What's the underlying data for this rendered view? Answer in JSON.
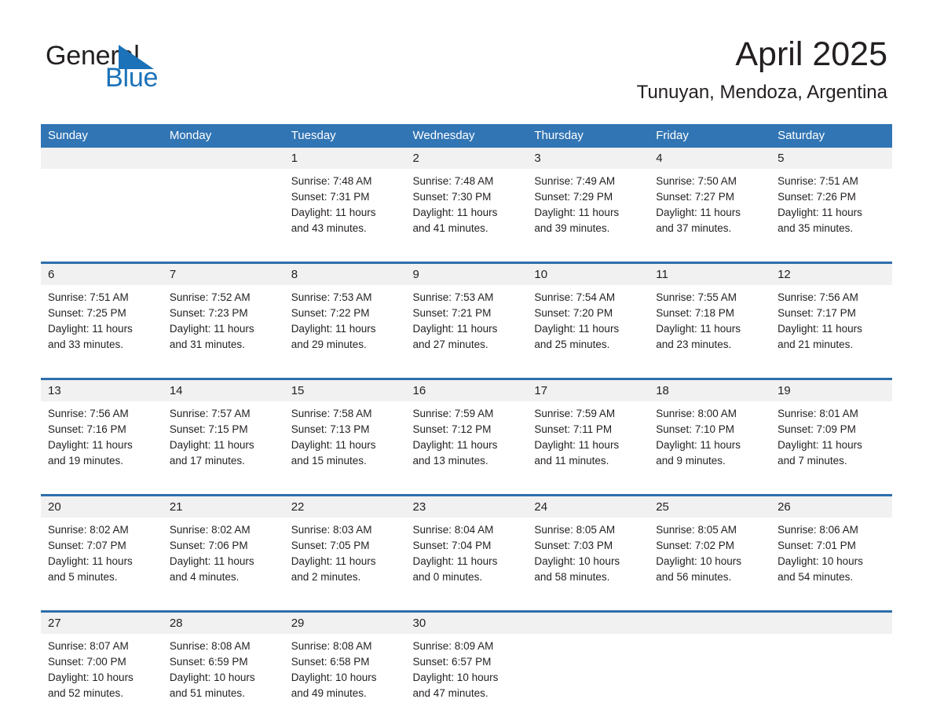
{
  "logo": {
    "text_top": "General",
    "text_bottom": "Blue",
    "triangle_icon": "blue-triangle-icon",
    "accent_color": "#1b72b8"
  },
  "header": {
    "title": "April 2025",
    "location": "Tunuyan, Mendoza, Argentina"
  },
  "colors": {
    "header_blue": "#3175b4",
    "separator_blue": "#2e6fab",
    "daynum_band": "#f1f1f1",
    "text": "#231f20"
  },
  "weekdays": [
    "Sunday",
    "Monday",
    "Tuesday",
    "Wednesday",
    "Thursday",
    "Friday",
    "Saturday"
  ],
  "weeks": [
    [
      {
        "day": "",
        "l1": "",
        "l2": "",
        "l3": "",
        "l4": ""
      },
      {
        "day": "",
        "l1": "",
        "l2": "",
        "l3": "",
        "l4": ""
      },
      {
        "day": "1",
        "l1": "Sunrise: 7:48 AM",
        "l2": "Sunset: 7:31 PM",
        "l3": "Daylight: 11 hours",
        "l4": "and 43 minutes."
      },
      {
        "day": "2",
        "l1": "Sunrise: 7:48 AM",
        "l2": "Sunset: 7:30 PM",
        "l3": "Daylight: 11 hours",
        "l4": "and 41 minutes."
      },
      {
        "day": "3",
        "l1": "Sunrise: 7:49 AM",
        "l2": "Sunset: 7:29 PM",
        "l3": "Daylight: 11 hours",
        "l4": "and 39 minutes."
      },
      {
        "day": "4",
        "l1": "Sunrise: 7:50 AM",
        "l2": "Sunset: 7:27 PM",
        "l3": "Daylight: 11 hours",
        "l4": "and 37 minutes."
      },
      {
        "day": "5",
        "l1": "Sunrise: 7:51 AM",
        "l2": "Sunset: 7:26 PM",
        "l3": "Daylight: 11 hours",
        "l4": "and 35 minutes."
      }
    ],
    [
      {
        "day": "6",
        "l1": "Sunrise: 7:51 AM",
        "l2": "Sunset: 7:25 PM",
        "l3": "Daylight: 11 hours",
        "l4": "and 33 minutes."
      },
      {
        "day": "7",
        "l1": "Sunrise: 7:52 AM",
        "l2": "Sunset: 7:23 PM",
        "l3": "Daylight: 11 hours",
        "l4": "and 31 minutes."
      },
      {
        "day": "8",
        "l1": "Sunrise: 7:53 AM",
        "l2": "Sunset: 7:22 PM",
        "l3": "Daylight: 11 hours",
        "l4": "and 29 minutes."
      },
      {
        "day": "9",
        "l1": "Sunrise: 7:53 AM",
        "l2": "Sunset: 7:21 PM",
        "l3": "Daylight: 11 hours",
        "l4": "and 27 minutes."
      },
      {
        "day": "10",
        "l1": "Sunrise: 7:54 AM",
        "l2": "Sunset: 7:20 PM",
        "l3": "Daylight: 11 hours",
        "l4": "and 25 minutes."
      },
      {
        "day": "11",
        "l1": "Sunrise: 7:55 AM",
        "l2": "Sunset: 7:18 PM",
        "l3": "Daylight: 11 hours",
        "l4": "and 23 minutes."
      },
      {
        "day": "12",
        "l1": "Sunrise: 7:56 AM",
        "l2": "Sunset: 7:17 PM",
        "l3": "Daylight: 11 hours",
        "l4": "and 21 minutes."
      }
    ],
    [
      {
        "day": "13",
        "l1": "Sunrise: 7:56 AM",
        "l2": "Sunset: 7:16 PM",
        "l3": "Daylight: 11 hours",
        "l4": "and 19 minutes."
      },
      {
        "day": "14",
        "l1": "Sunrise: 7:57 AM",
        "l2": "Sunset: 7:15 PM",
        "l3": "Daylight: 11 hours",
        "l4": "and 17 minutes."
      },
      {
        "day": "15",
        "l1": "Sunrise: 7:58 AM",
        "l2": "Sunset: 7:13 PM",
        "l3": "Daylight: 11 hours",
        "l4": "and 15 minutes."
      },
      {
        "day": "16",
        "l1": "Sunrise: 7:59 AM",
        "l2": "Sunset: 7:12 PM",
        "l3": "Daylight: 11 hours",
        "l4": "and 13 minutes."
      },
      {
        "day": "17",
        "l1": "Sunrise: 7:59 AM",
        "l2": "Sunset: 7:11 PM",
        "l3": "Daylight: 11 hours",
        "l4": "and 11 minutes."
      },
      {
        "day": "18",
        "l1": "Sunrise: 8:00 AM",
        "l2": "Sunset: 7:10 PM",
        "l3": "Daylight: 11 hours",
        "l4": "and 9 minutes."
      },
      {
        "day": "19",
        "l1": "Sunrise: 8:01 AM",
        "l2": "Sunset: 7:09 PM",
        "l3": "Daylight: 11 hours",
        "l4": "and 7 minutes."
      }
    ],
    [
      {
        "day": "20",
        "l1": "Sunrise: 8:02 AM",
        "l2": "Sunset: 7:07 PM",
        "l3": "Daylight: 11 hours",
        "l4": "and 5 minutes."
      },
      {
        "day": "21",
        "l1": "Sunrise: 8:02 AM",
        "l2": "Sunset: 7:06 PM",
        "l3": "Daylight: 11 hours",
        "l4": "and 4 minutes."
      },
      {
        "day": "22",
        "l1": "Sunrise: 8:03 AM",
        "l2": "Sunset: 7:05 PM",
        "l3": "Daylight: 11 hours",
        "l4": "and 2 minutes."
      },
      {
        "day": "23",
        "l1": "Sunrise: 8:04 AM",
        "l2": "Sunset: 7:04 PM",
        "l3": "Daylight: 11 hours",
        "l4": "and 0 minutes."
      },
      {
        "day": "24",
        "l1": "Sunrise: 8:05 AM",
        "l2": "Sunset: 7:03 PM",
        "l3": "Daylight: 10 hours",
        "l4": "and 58 minutes."
      },
      {
        "day": "25",
        "l1": "Sunrise: 8:05 AM",
        "l2": "Sunset: 7:02 PM",
        "l3": "Daylight: 10 hours",
        "l4": "and 56 minutes."
      },
      {
        "day": "26",
        "l1": "Sunrise: 8:06 AM",
        "l2": "Sunset: 7:01 PM",
        "l3": "Daylight: 10 hours",
        "l4": "and 54 minutes."
      }
    ],
    [
      {
        "day": "27",
        "l1": "Sunrise: 8:07 AM",
        "l2": "Sunset: 7:00 PM",
        "l3": "Daylight: 10 hours",
        "l4": "and 52 minutes."
      },
      {
        "day": "28",
        "l1": "Sunrise: 8:08 AM",
        "l2": "Sunset: 6:59 PM",
        "l3": "Daylight: 10 hours",
        "l4": "and 51 minutes."
      },
      {
        "day": "29",
        "l1": "Sunrise: 8:08 AM",
        "l2": "Sunset: 6:58 PM",
        "l3": "Daylight: 10 hours",
        "l4": "and 49 minutes."
      },
      {
        "day": "30",
        "l1": "Sunrise: 8:09 AM",
        "l2": "Sunset: 6:57 PM",
        "l3": "Daylight: 10 hours",
        "l4": "and 47 minutes."
      },
      {
        "day": "",
        "l1": "",
        "l2": "",
        "l3": "",
        "l4": ""
      },
      {
        "day": "",
        "l1": "",
        "l2": "",
        "l3": "",
        "l4": ""
      },
      {
        "day": "",
        "l1": "",
        "l2": "",
        "l3": "",
        "l4": ""
      }
    ]
  ]
}
